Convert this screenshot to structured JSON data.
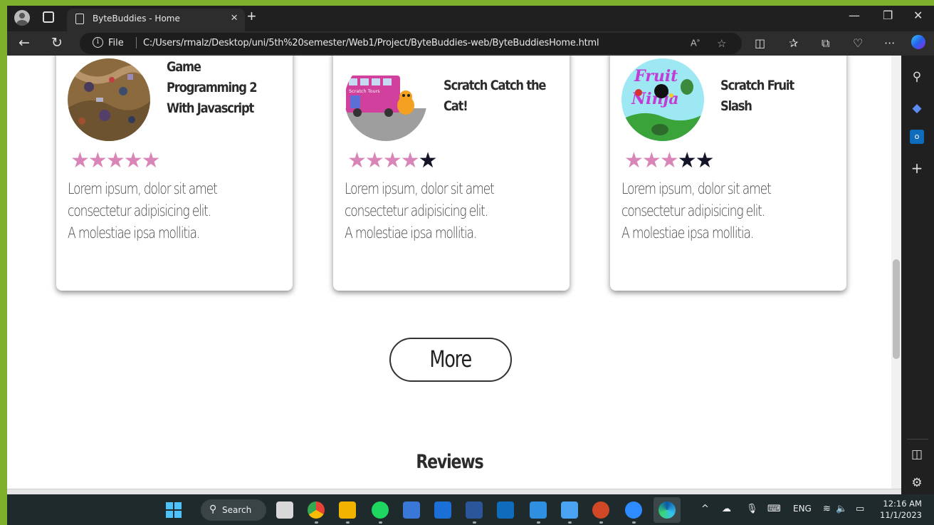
{
  "browser": {
    "tab_title": "ByteBuddies - Home",
    "tab_close": "×",
    "new_tab": "+",
    "address_prefix": "File",
    "url": "C:/Users/rmalz/Desktop/uni/5th%20semester/Web1/Project/ByteBuddies-web/ByteBuddiesHome.html",
    "minimize": "—",
    "restore": "❐",
    "close": "✕"
  },
  "cards": [
    {
      "title_lines": [
        "Game",
        "Programming 2",
        "With Javascript"
      ],
      "rating": 5,
      "desc_lines": [
        "Lorem ipsum, dolor sit amet",
        "consectetur adipisicing elit.",
        "A molestiae ipsa mollitia."
      ]
    },
    {
      "title_lines": [
        "Scratch Catch the",
        "Cat!"
      ],
      "rating": 4,
      "thumb_text": "Scratch Tours",
      "desc_lines": [
        "Lorem ipsum, dolor sit amet",
        "consectetur adipisicing elit.",
        "A molestiae ipsa mollitia."
      ]
    },
    {
      "title_lines": [
        "Scratch Fruit",
        "Slash"
      ],
      "rating": 3,
      "thumb_text": [
        "Fruit",
        "Ninja"
      ],
      "desc_lines": [
        "Lorem ipsum, dolor sit amet",
        "consectetur adipisicing elit.",
        "A molestiae ipsa mollitia."
      ]
    }
  ],
  "star_glyph": "★",
  "more_button": "More",
  "reviews_heading": "Reviews",
  "colors": {
    "star_filled": "#d985b8",
    "star_empty": "#141428",
    "accent_frame": "#7fb02c"
  },
  "taskbar": {
    "search_label": "Search",
    "language": "ENG",
    "time": "12:16 AM",
    "date": "11/1/2023"
  }
}
